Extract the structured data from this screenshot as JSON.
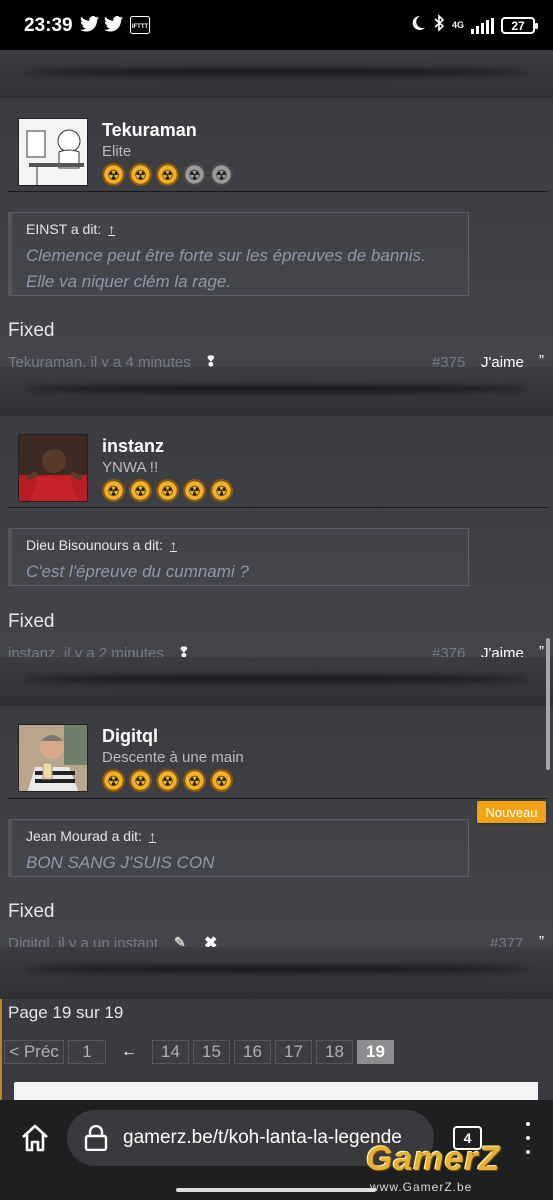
{
  "status": {
    "time": "23:39",
    "network": "4G",
    "battery": "27"
  },
  "posts": [
    {
      "username": "Tekuraman",
      "rank": "Elite",
      "stars_active": 3,
      "stars_total": 5,
      "quote_author": "EINST a dit:",
      "quote_up": "↑",
      "quote_text": "Clemence peut être forte sur les épreuves de bannis. Elle va niquer clém la rage.",
      "body": "Fixed",
      "meta": "Tekuraman, il y a 4 minutes",
      "number": "#375",
      "like": "J'aime",
      "quote_icon": "”"
    },
    {
      "username": "instanz",
      "rank": "YNWA !!",
      "stars_active": 5,
      "stars_total": 5,
      "quote_author": "Dieu Bisounours a dit:",
      "quote_up": "↑",
      "quote_text": "C'est l'épreuve du cumnami ?",
      "body": "Fixed",
      "meta": "instanz, il y a 2 minutes",
      "number": "#376",
      "like": "J'aime",
      "quote_icon": "”"
    },
    {
      "username": "Digitql",
      "rank": "Descente à une main",
      "stars_active": 5,
      "stars_total": 5,
      "badge": "Nouveau",
      "quote_author": "Jean Mourad a dit:",
      "quote_up": "↑",
      "quote_text": "BON SANG J'SUIS CON",
      "body": "Fixed",
      "meta": "Digitql, il y a un instant",
      "number": "#377",
      "quote_icon": "”"
    }
  ],
  "pagination": {
    "info": "Page 19 sur 19",
    "prev": "< Préc",
    "first": "1",
    "ellipsis_arrow": "←",
    "pages": [
      "14",
      "15",
      "16",
      "17",
      "18",
      "19"
    ],
    "current": "19"
  },
  "browser": {
    "url": "gamerz.be/t/koh-lanta-la-legende",
    "tab_count": "4"
  },
  "watermark": {
    "brand": "GamerZ",
    "site": "www.GamerZ.be"
  },
  "icons": {
    "home": "home-icon",
    "lock": "lock-icon",
    "menu": "more-vert-icon"
  }
}
